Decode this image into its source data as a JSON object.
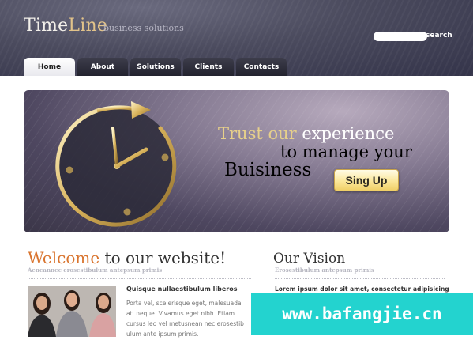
{
  "header": {
    "logo_time": "Time",
    "logo_line": "Line",
    "tagline": "business solutions",
    "search_label": "search",
    "search_placeholder": ""
  },
  "nav": {
    "tabs": [
      "Home",
      "About",
      "Solutions",
      "Clients",
      "Contacts"
    ],
    "active": "Home"
  },
  "banner": {
    "line1_gold": "Trust our",
    "line1_white": " experience",
    "line2": "to manage your",
    "line3": "Buisiness",
    "button_label": "Sing Up"
  },
  "welcome": {
    "heading_accent": "Welcome",
    "heading_rest": " to our website!",
    "subheading": "Aeneannec erosestibulum antepsum primis",
    "article_title": "Quisque nullaestibulum liberos",
    "article_lines": [
      "Porta vel, scelerisque eget, malesuada",
      "at, neque. Vivamus eget nibh. Etiam",
      "cursus leo vel metusnean nec erosestib",
      "ulum ante ipsum primis."
    ]
  },
  "vision": {
    "heading": "Our Vision",
    "subheading": "Erosestibulum antepsum primis",
    "text": "Lorem ipsum dolor sit amet, consectetur adipisicing"
  },
  "watermark": "www.bafangjie.cn",
  "colors": {
    "accent_orange": "#d9742e",
    "gold": "#e7d08a",
    "header_dark": "#3e3e52",
    "watermark_teal": "#23d3cf"
  }
}
